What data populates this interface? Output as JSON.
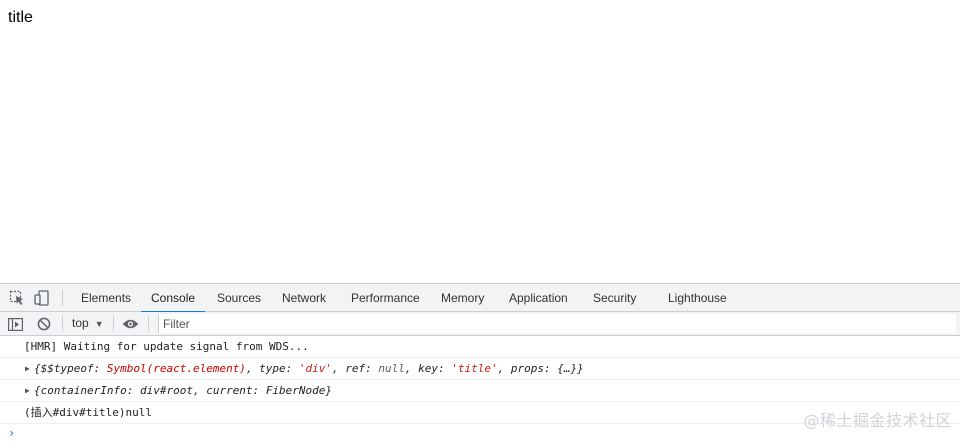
{
  "page": {
    "title": "title"
  },
  "devtools": {
    "tabs": [
      {
        "label": "Elements"
      },
      {
        "label": "Console"
      },
      {
        "label": "Sources"
      },
      {
        "label": "Network"
      },
      {
        "label": "Performance"
      },
      {
        "label": "Memory"
      },
      {
        "label": "Application"
      },
      {
        "label": "Security"
      },
      {
        "label": "Lighthouse"
      }
    ],
    "active_tab": "Console",
    "toolbar": {
      "context": "top",
      "filter_placeholder": "Filter"
    },
    "messages": {
      "hmr": "[HMR] Waiting for update signal from WDS...",
      "element": {
        "open": "{$$typeof: ",
        "symbol": "Symbol(react.element)",
        "type_key": ", type: ",
        "type_val": "'div'",
        "ref_key": ", ref: ",
        "ref_val": "null",
        "key_key": ", key: ",
        "key_val": "'title'",
        "props_key": ", props: ",
        "props_val": "{…}}"
      },
      "fiber": {
        "open": "{containerInfo: ",
        "container": "div#root",
        "current_key": ", current: ",
        "current_val": "FiberNode",
        "close": "}"
      },
      "insert": "(插入#div#title)null"
    },
    "prompt": "›"
  },
  "watermark": "@稀土掘金技术社区",
  "colors": {
    "accent": "#1a73e8",
    "toolbar_bg": "#f1f3f4",
    "string": "#c41a16",
    "symbol": "#c80000"
  }
}
